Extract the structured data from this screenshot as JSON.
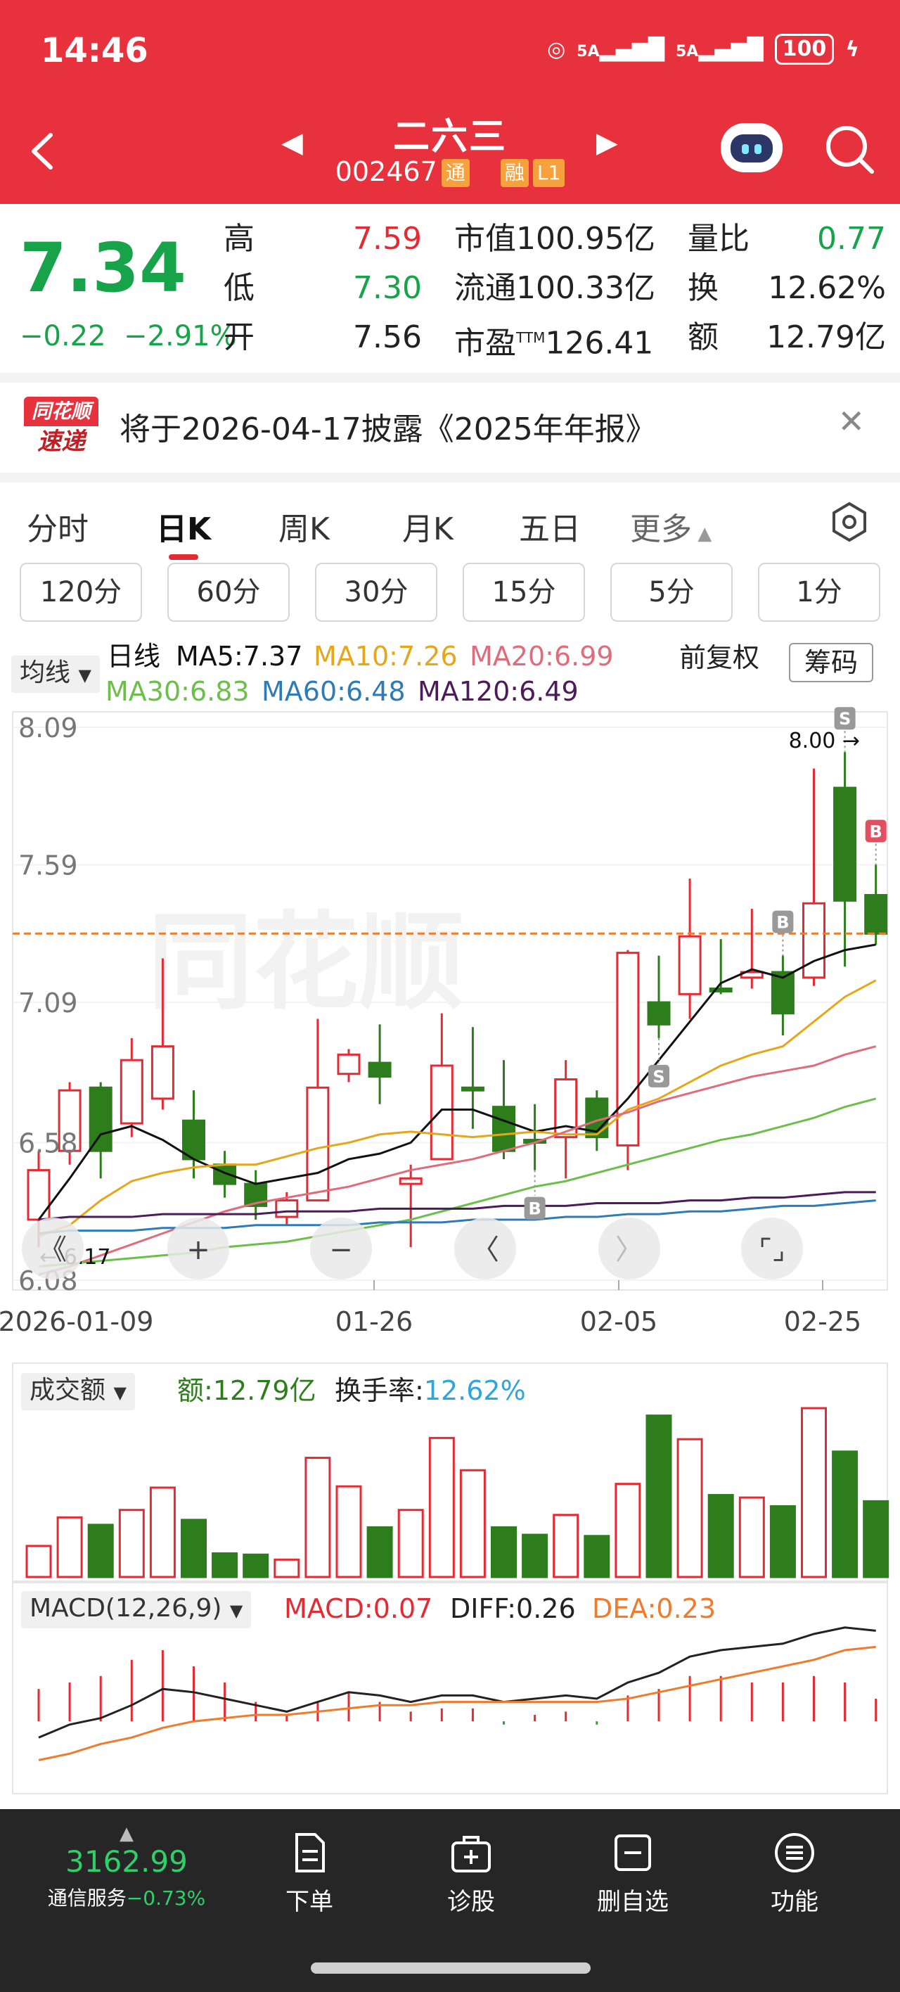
{
  "status_bar": {
    "time": "14:46",
    "sig1": "5A",
    "sig2": "5A",
    "battery": "100"
  },
  "header": {
    "title": "二六三",
    "code": "002467",
    "tag_tong": "通",
    "tag_rong": "融",
    "tag_level": "L1"
  },
  "quote": {
    "price": "7.34",
    "change": "−0.22",
    "change_pct": "−2.91%",
    "high_label": "高",
    "high": "7.59",
    "low_label": "低",
    "low": "7.30",
    "open_label": "开",
    "open": "7.56",
    "mcap_label": "市值",
    "mcap": "100.95亿",
    "float_label": "流通",
    "float": "100.33亿",
    "pe_label": "市盈",
    "pe_sup": "TTM",
    "pe": "126.41",
    "vr_label": "量比",
    "vr": "0.77",
    "turnover_label": "换",
    "turnover": "12.62%",
    "amount_label": "额",
    "amount": "12.79亿"
  },
  "notice": {
    "logo_top": "同花顺",
    "logo_bottom": "速递",
    "text": "将于2026-04-17披露《2025年年报》"
  },
  "tabs": [
    "分时",
    "日K",
    "周K",
    "月K",
    "五日",
    "更多"
  ],
  "active_tab": "日K",
  "intervals": [
    "120分",
    "60分",
    "30分",
    "15分",
    "5分",
    "1分"
  ],
  "indicator": {
    "selector": "均线",
    "line_label": "日线",
    "ma5": "MA5:7.37",
    "ma10": "MA10:7.26",
    "ma20": "MA20:6.99",
    "ma30": "MA30:6.83",
    "ma60": "MA60:6.48",
    "ma120": "MA120:6.49",
    "adjust": "前复权",
    "chip_button": "筹码"
  },
  "colors": {
    "up": "#e42b34",
    "down": "#2d7d1c",
    "ma5": "#111111",
    "ma10": "#e6a61a",
    "ma20": "#e06b7a",
    "ma30": "#6bbf4a",
    "ma60": "#2f7bb5",
    "ma120": "#4d1a5a",
    "header_bg": "#e7323d"
  },
  "chart_controls": [
    "fast-back",
    "zoom-in",
    "zoom-out",
    "prev",
    "next",
    "fullscreen"
  ],
  "chart_data": [
    {
      "type": "candlestick",
      "y_ticks": [
        "8.09",
        "7.59",
        "7.09",
        "6.58",
        "6.08"
      ],
      "ylim": [
        6.08,
        8.09
      ],
      "x_labels": [
        "2026-01-09",
        "01-26",
        "02-05",
        "02-25"
      ],
      "max_label": "8.00",
      "min_label": "6.17",
      "current_price_line": 7.34,
      "candles": [
        {
          "o": 6.3,
          "c": 6.48,
          "h": 6.55,
          "l": 6.2
        },
        {
          "o": 6.55,
          "c": 6.77,
          "h": 6.8,
          "l": 6.5
        },
        {
          "o": 6.78,
          "c": 6.55,
          "h": 6.8,
          "l": 6.45
        },
        {
          "o": 6.65,
          "c": 6.88,
          "h": 6.96,
          "l": 6.6
        },
        {
          "o": 6.74,
          "c": 6.93,
          "h": 7.25,
          "l": 6.7
        },
        {
          "o": 6.66,
          "c": 6.52,
          "h": 6.77,
          "l": 6.45
        },
        {
          "o": 6.5,
          "c": 6.43,
          "h": 6.55,
          "l": 6.38
        },
        {
          "o": 6.43,
          "c": 6.35,
          "h": 6.48,
          "l": 6.3
        },
        {
          "o": 6.31,
          "c": 6.37,
          "h": 6.4,
          "l": 6.28
        },
        {
          "o": 6.37,
          "c": 6.78,
          "h": 7.03,
          "l": 6.37
        },
        {
          "o": 6.83,
          "c": 6.9,
          "h": 6.92,
          "l": 6.8
        },
        {
          "o": 6.87,
          "c": 6.82,
          "h": 7.01,
          "l": 6.72
        },
        {
          "o": 6.43,
          "c": 6.45,
          "h": 6.5,
          "l": 6.2
        },
        {
          "o": 6.52,
          "c": 6.86,
          "h": 7.05,
          "l": 6.52
        },
        {
          "o": 6.78,
          "c": 6.77,
          "h": 7.0,
          "l": 6.63
        },
        {
          "o": 6.71,
          "c": 6.55,
          "h": 6.88,
          "l": 6.52
        },
        {
          "o": 6.59,
          "c": 6.58,
          "h": 6.72,
          "l": 6.48
        },
        {
          "o": 6.6,
          "c": 6.81,
          "h": 6.88,
          "l": 6.45
        },
        {
          "o": 6.74,
          "c": 6.6,
          "h": 6.77,
          "l": 6.55
        },
        {
          "o": 6.57,
          "c": 7.27,
          "h": 7.28,
          "l": 6.48
        },
        {
          "o": 7.09,
          "c": 7.01,
          "h": 7.26,
          "l": 6.96
        },
        {
          "o": 7.12,
          "c": 7.33,
          "h": 7.54,
          "l": 7.03
        },
        {
          "o": 7.14,
          "c": 7.13,
          "h": 7.32,
          "l": 7.12
        },
        {
          "o": 7.18,
          "c": 7.2,
          "h": 7.43,
          "l": 7.14
        },
        {
          "o": 7.2,
          "c": 7.05,
          "h": 7.26,
          "l": 6.97
        },
        {
          "o": 7.18,
          "c": 7.45,
          "h": 7.94,
          "l": 7.15
        },
        {
          "o": 7.87,
          "c": 7.46,
          "h": 8.0,
          "l": 7.22
        },
        {
          "o": 7.48,
          "c": 7.34,
          "h": 7.59,
          "l": 7.3
        }
      ],
      "ma_series": [
        {
          "name": "MA5",
          "values": [
            6.3,
            6.45,
            6.61,
            6.64,
            6.59,
            6.52,
            6.47,
            6.43,
            6.45,
            6.47,
            6.52,
            6.54,
            6.58,
            6.7,
            6.7,
            6.66,
            6.62,
            6.64,
            6.62,
            6.74,
            6.88,
            7.02,
            7.16,
            7.21,
            7.18,
            7.24,
            7.28,
            7.3
          ]
        },
        {
          "name": "MA10",
          "values": [
            6.24,
            6.28,
            6.37,
            6.44,
            6.47,
            6.49,
            6.5,
            6.5,
            6.53,
            6.56,
            6.58,
            6.61,
            6.62,
            6.61,
            6.6,
            6.61,
            6.62,
            6.61,
            6.61,
            6.7,
            6.74,
            6.8,
            6.86,
            6.9,
            6.93,
            7.02,
            7.11,
            7.17
          ]
        },
        {
          "name": "MA20",
          "values": [
            6.1,
            6.13,
            6.17,
            6.21,
            6.25,
            6.29,
            6.33,
            6.36,
            6.38,
            6.4,
            6.42,
            6.45,
            6.48,
            6.5,
            6.52,
            6.55,
            6.58,
            6.62,
            6.66,
            6.69,
            6.73,
            6.76,
            6.79,
            6.82,
            6.84,
            6.86,
            6.9,
            6.93
          ]
        },
        {
          "name": "MA30",
          "values": [
            6.13,
            6.14,
            6.15,
            6.16,
            6.17,
            6.18,
            6.2,
            6.21,
            6.22,
            6.24,
            6.26,
            6.28,
            6.3,
            6.33,
            6.36,
            6.39,
            6.42,
            6.44,
            6.47,
            6.5,
            6.53,
            6.56,
            6.59,
            6.61,
            6.64,
            6.67,
            6.71,
            6.74
          ]
        },
        {
          "name": "MA60",
          "values": [
            6.25,
            6.26,
            6.26,
            6.26,
            6.27,
            6.27,
            6.27,
            6.28,
            6.28,
            6.28,
            6.28,
            6.29,
            6.29,
            6.29,
            6.3,
            6.3,
            6.3,
            6.31,
            6.31,
            6.32,
            6.32,
            6.33,
            6.33,
            6.34,
            6.35,
            6.35,
            6.36,
            6.37
          ]
        },
        {
          "name": "MA120",
          "values": [
            6.3,
            6.31,
            6.31,
            6.31,
            6.32,
            6.32,
            6.32,
            6.32,
            6.33,
            6.33,
            6.33,
            6.34,
            6.34,
            6.34,
            6.34,
            6.35,
            6.35,
            6.35,
            6.36,
            6.36,
            6.36,
            6.37,
            6.37,
            6.38,
            6.38,
            6.39,
            6.4,
            6.4
          ]
        }
      ],
      "markers": [
        {
          "label": "S",
          "index": 26,
          "position": "above",
          "color": "#999999"
        },
        {
          "label": "B",
          "index": 27,
          "position": "above",
          "color": "#e05060"
        },
        {
          "label": "B",
          "index": 24,
          "position": "above",
          "color": "#999999"
        },
        {
          "label": "S",
          "index": 20,
          "position": "below",
          "color": "#999999"
        },
        {
          "label": "B",
          "index": 16,
          "position": "below",
          "color": "#999999"
        }
      ]
    },
    {
      "type": "bar",
      "title": "成交额",
      "amount_label": "额:",
      "amount": "12.79亿",
      "turnover_label": "换手率:",
      "turnover": "12.62%",
      "values": [
        2.5,
        4.8,
        4.2,
        5.4,
        7.2,
        4.6,
        1.9,
        1.8,
        1.4,
        9.6,
        7.3,
        4.0,
        5.4,
        11.2,
        8.6,
        4.0,
        3.4,
        5.0,
        3.3,
        7.5,
        13.0,
        11.1,
        6.6,
        6.4,
        5.7,
        13.6,
        10.1,
        6.1
      ],
      "up": [
        true,
        true,
        false,
        true,
        true,
        false,
        false,
        false,
        true,
        true,
        true,
        false,
        true,
        true,
        true,
        false,
        false,
        true,
        false,
        true,
        false,
        true,
        false,
        true,
        false,
        true,
        false,
        false
      ]
    },
    {
      "type": "macd",
      "title": "MACD(12,26,9)",
      "macd": "MACD:0.07",
      "diff": "DIFF:0.26",
      "dea": "DEA:0.23",
      "diff_values": [
        -0.05,
        -0.01,
        0.01,
        0.05,
        0.1,
        0.09,
        0.07,
        0.05,
        0.03,
        0.06,
        0.09,
        0.08,
        0.06,
        0.08,
        0.08,
        0.06,
        0.07,
        0.08,
        0.07,
        0.12,
        0.15,
        0.2,
        0.22,
        0.23,
        0.24,
        0.27,
        0.29,
        0.28
      ],
      "dea_values": [
        -0.12,
        -0.1,
        -0.07,
        -0.05,
        -0.02,
        0.0,
        0.01,
        0.02,
        0.02,
        0.03,
        0.04,
        0.05,
        0.05,
        0.06,
        0.06,
        0.06,
        0.06,
        0.06,
        0.06,
        0.07,
        0.09,
        0.11,
        0.13,
        0.15,
        0.17,
        0.19,
        0.22,
        0.23
      ],
      "hist_values": [
        0.1,
        0.12,
        0.14,
        0.19,
        0.22,
        0.17,
        0.12,
        0.06,
        0.02,
        0.06,
        0.09,
        0.06,
        0.03,
        0.04,
        0.04,
        -0.01,
        0.02,
        0.03,
        -0.01,
        0.08,
        0.1,
        0.14,
        0.14,
        0.12,
        0.12,
        0.14,
        0.12,
        0.07
      ]
    }
  ],
  "bottom_bar": {
    "index_value": "3162.99",
    "index_name": "通信服务",
    "index_change": "−0.73%",
    "items": [
      "下单",
      "诊股",
      "删自选",
      "功能"
    ]
  }
}
